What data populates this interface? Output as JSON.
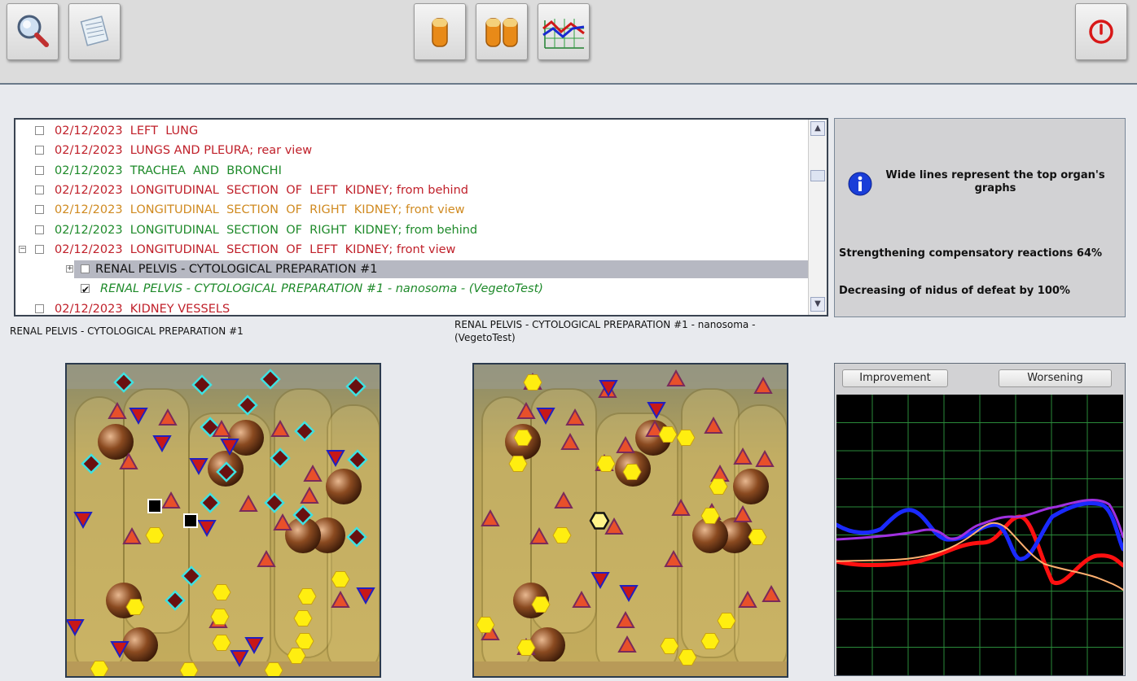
{
  "toolbar": {
    "buttons": [
      {
        "name": "search-icon",
        "id": "search"
      },
      {
        "name": "notes-icon",
        "id": "notes"
      },
      {
        "name": "single-capsule-icon",
        "id": "single"
      },
      {
        "name": "double-capsule-icon",
        "id": "double"
      },
      {
        "name": "graph-icon",
        "id": "graph"
      },
      {
        "name": "power-icon",
        "id": "power"
      }
    ]
  },
  "list": {
    "rows": [
      {
        "text": "02/12/2023  LEFT  LUNG",
        "color": "red",
        "indent": 0,
        "checked": false,
        "expander": ""
      },
      {
        "text": "02/12/2023  LUNGS AND PLEURA; rear view",
        "color": "red",
        "indent": 0,
        "checked": false,
        "expander": ""
      },
      {
        "text": "02/12/2023  TRACHEA  AND  BRONCHI",
        "color": "green",
        "indent": 0,
        "checked": false,
        "expander": ""
      },
      {
        "text": "02/12/2023  LONGITUDINAL  SECTION  OF  LEFT  KIDNEY; from behind",
        "color": "red",
        "indent": 0,
        "checked": false,
        "expander": ""
      },
      {
        "text": "02/12/2023  LONGITUDINAL  SECTION  OF  RIGHT  KIDNEY; front view",
        "color": "orange",
        "indent": 0,
        "checked": false,
        "expander": ""
      },
      {
        "text": "02/12/2023  LONGITUDINAL  SECTION  OF  RIGHT  KIDNEY; from behind",
        "color": "green",
        "indent": 0,
        "checked": false,
        "expander": ""
      },
      {
        "text": "02/12/2023  LONGITUDINAL  SECTION  OF  LEFT  KIDNEY; front view",
        "color": "red",
        "indent": 0,
        "checked": false,
        "expander": "minus"
      },
      {
        "text": "RENAL PELVIS - CYTOLOGICAL PREPARATION #1",
        "color": "black",
        "indent": 1,
        "checked": false,
        "expander": "plus",
        "selected": true
      },
      {
        "text": "RENAL PELVIS - CYTOLOGICAL PREPARATION #1 - nanosoma - (VegetoTest)",
        "color": "green",
        "indent": 2,
        "checked": true,
        "expander": "",
        "italic": true
      },
      {
        "text": "02/12/2023  KIDNEY VESSELS",
        "color": "red",
        "indent": 0,
        "checked": false,
        "expander": ""
      }
    ]
  },
  "info": {
    "tip": "Wide lines represent the top organ's graphs",
    "line1": "Strengthening compensatory reactions 64%",
    "line2": "Decreasing of nidus of defeat by 100%"
  },
  "captions": {
    "left": "RENAL PELVIS - CYTOLOGICAL PREPARATION #1",
    "right": "RENAL PELVIS - CYTOLOGICAL PREPARATION #1 - nanosoma - (VegetoTest)"
  },
  "graph": {
    "improvement_label": "Improvement",
    "worsening_label": "Worsening",
    "series_colors": [
      "#ff1010",
      "#1a2aff",
      "#a030e0",
      "#ffb070"
    ]
  },
  "colors": {
    "red_text": "#c0202a",
    "green_text": "#1e8a2a",
    "orange_text": "#d08a20"
  }
}
